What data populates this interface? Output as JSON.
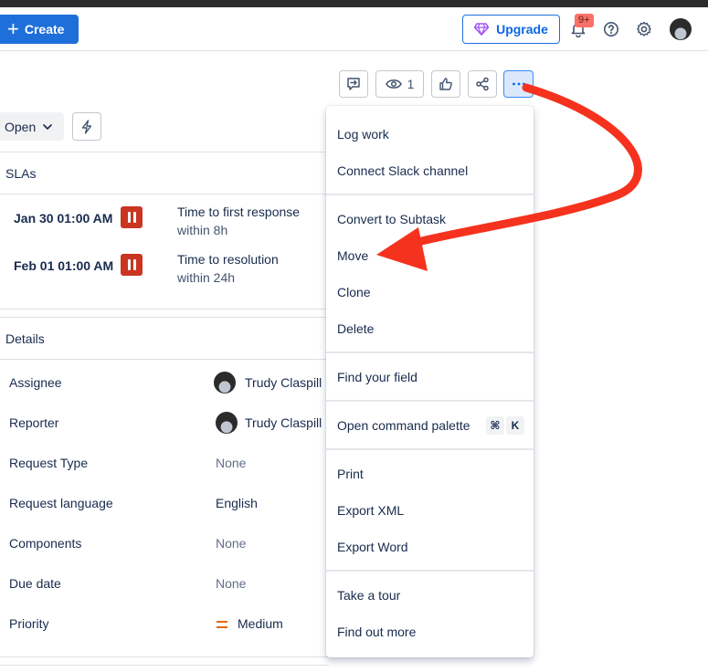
{
  "header": {
    "create_label": "Create",
    "upgrade_label": "Upgrade",
    "notification_badge": "9+",
    "icons": [
      "bell-icon",
      "help-icon",
      "gear-icon",
      "avatar"
    ]
  },
  "actions": {
    "watch_count": "1",
    "icons": [
      "feedback-icon",
      "eye-icon",
      "thumbs-up-icon",
      "share-icon",
      "more-icon"
    ]
  },
  "status": {
    "label": "Open"
  },
  "sla": {
    "title": "SLAs",
    "items": [
      {
        "date": "Jan 30 01:00 AM",
        "name": "Time to first response",
        "goal": "within 8h"
      },
      {
        "date": "Feb 01 01:00 AM",
        "name": "Time to resolution",
        "goal": "within 24h"
      }
    ]
  },
  "details": {
    "title": "Details",
    "fields": [
      {
        "label": "Assignee",
        "value": "Trudy Claspill"
      },
      {
        "label": "Reporter",
        "value": "Trudy Claspill"
      },
      {
        "label": "Request Type",
        "value": "None"
      },
      {
        "label": "Request language",
        "value": "English"
      },
      {
        "label": "Components",
        "value": "None"
      },
      {
        "label": "Due date",
        "value": "None"
      },
      {
        "label": "Priority",
        "value": "Medium"
      }
    ]
  },
  "menu": {
    "items": [
      "Log work",
      "Connect Slack channel",
      "Convert to Subtask",
      "Move",
      "Clone",
      "Delete",
      "Find your field",
      "Open command palette",
      "Print",
      "Export XML",
      "Export Word",
      "Take a tour",
      "Find out more"
    ],
    "shortcut_keys": [
      "⌘",
      "K"
    ]
  },
  "colors": {
    "brand": "#1f6fdb",
    "annotation_arrow": "#f5321e",
    "sla_paused": "#ca3521",
    "priority_medium": "#e56910"
  }
}
